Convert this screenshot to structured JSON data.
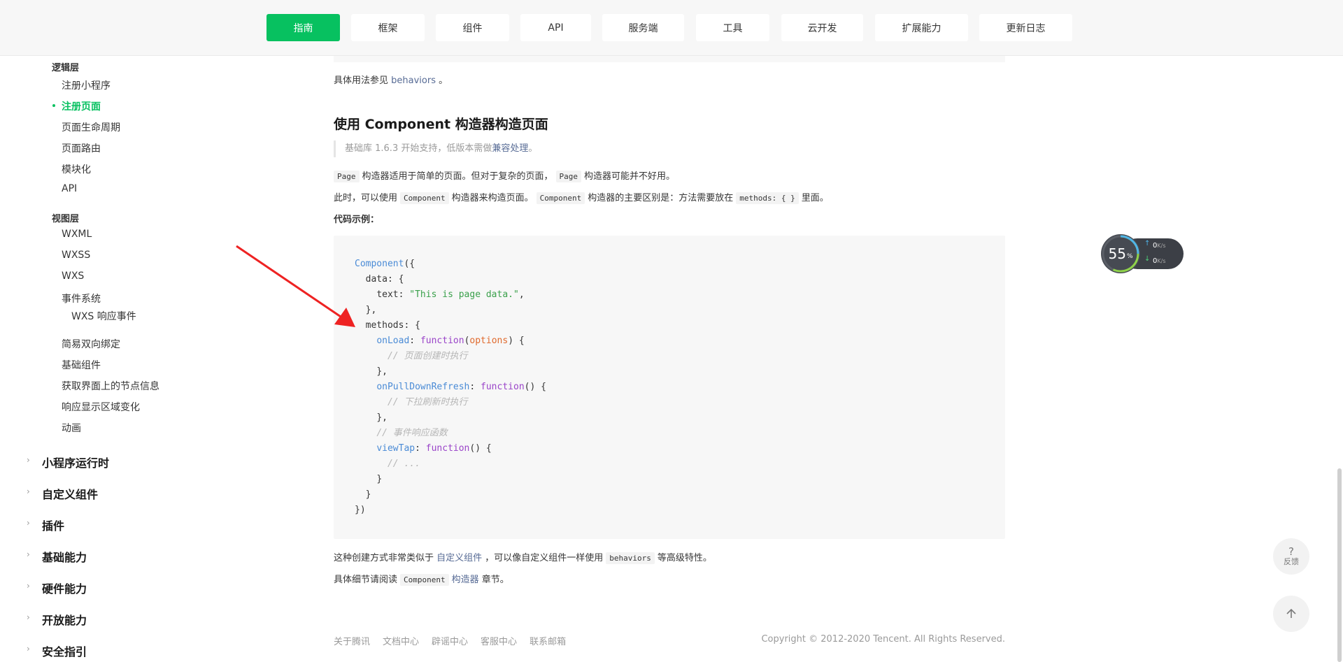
{
  "topnav": {
    "tabs": [
      {
        "label": "指南",
        "active": true
      },
      {
        "label": "框架"
      },
      {
        "label": "组件"
      },
      {
        "label": "API"
      },
      {
        "label": "服务端"
      },
      {
        "label": "工具"
      },
      {
        "label": "云开发"
      },
      {
        "label": "扩展能力"
      },
      {
        "label": "更新日志"
      }
    ]
  },
  "sidebar": {
    "logic_group": "逻辑层",
    "logic_items": [
      "注册小程序",
      "注册页面",
      "页面生命周期",
      "页面路由",
      "模块化",
      "API"
    ],
    "view_group": "视图层",
    "view_items": [
      "WXML",
      "WXSS",
      "WXS",
      "事件系统"
    ],
    "view_sub_item": "WXS 响应事件",
    "view_items_2": [
      "简易双向绑定",
      "基础组件",
      "获取界面上的节点信息",
      "响应显示区域变化",
      "动画"
    ],
    "top_sections": [
      "小程序运行时",
      "自定义组件",
      "插件",
      "基础能力",
      "硬件能力",
      "开放能力",
      "安全指引"
    ]
  },
  "content": {
    "behaviors_line": {
      "prefix": "具体用法参见 ",
      "link": "behaviors",
      "suffix": " 。"
    },
    "heading": "使用 Component 构造器构造页面",
    "tip": {
      "prefix": "基础库 1.6.3 开始支持，低版本需做",
      "link": "兼容处理",
      "suffix": "。"
    },
    "para1": {
      "code1": "Page",
      "mid": "构造器适用于简单的页面。但对于复杂的页面，",
      "code2": "Page",
      "suffix": "构造器可能并不好用。"
    },
    "para2": {
      "prefix": "此时，可以使用",
      "code1": "Component",
      "mid1": "构造器来构造页面。",
      "code2": "Component",
      "mid2": "构造器的主要区别是：方法需要放在",
      "code3": "methods: { }",
      "suffix": "里面。"
    },
    "example_label": "代码示例：",
    "para3": {
      "prefix": "这种创建方式非常类似于 ",
      "link": "自定义组件",
      "mid": " ，可以像自定义组件一样使用",
      "code": "behaviors",
      "suffix": "等高级特性。"
    },
    "para4": {
      "prefix": "具体细节请阅读",
      "code": "Component",
      "link": "构造器",
      "suffix": " 章节。"
    }
  },
  "code": {
    "l1_fn": "Component",
    "l1_rest": "({",
    "l2": "data: {",
    "l3_key": "text: ",
    "l3_str": "\"This is page data.\"",
    "l4": "},",
    "l5": "methods: {",
    "l6_fn": "onLoad",
    "l6_kw": "function",
    "l6_param": "options",
    "l7_com": "// 页面创建时执行",
    "l8": "},",
    "l9_fn": "onPullDownRefresh",
    "l9_kw": "function",
    "l10_com": "// 下拉刷新时执行",
    "l11": "},",
    "l12_com": "// 事件响应函数",
    "l13_fn": "viewTap",
    "l13_kw": "function",
    "l14_com": "// ...",
    "l15": "}",
    "l16": "}",
    "l17": "})"
  },
  "footer": {
    "links": [
      "关于腾讯",
      "文档中心",
      "辟谣中心",
      "客服中心",
      "联系邮箱"
    ],
    "copyright": "Copyright © 2012-2020 Tencent. All Rights Reserved."
  },
  "float": {
    "feedback_icon": "?",
    "feedback_label": "反馈",
    "top_icon": "arrow-up-icon"
  },
  "netwidget": {
    "percent": "55",
    "percent_unit": "%",
    "upload": "0",
    "download": "0",
    "unit": "K/s"
  },
  "colors": {
    "accent": "#07c160",
    "link": "#576b95",
    "annotation_arrow": "#ee2222"
  }
}
